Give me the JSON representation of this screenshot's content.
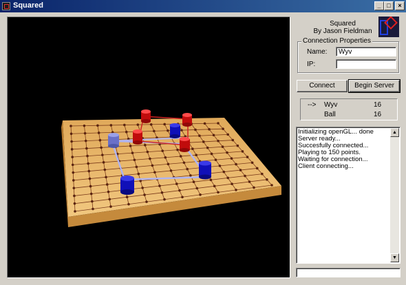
{
  "window": {
    "title": "Squared",
    "minimize_glyph": "_",
    "maximize_glyph": "□",
    "close_glyph": "×"
  },
  "credits": {
    "line1": "Squared",
    "line2": "By Jason Fieldman"
  },
  "connection": {
    "group_title": "Connection Properties",
    "name_label": "Name:",
    "name_value": "Wyv",
    "ip_label": "IP:",
    "ip_value": ""
  },
  "buttons": {
    "connect": "Connect",
    "begin_server": "Begin Server"
  },
  "scores": [
    {
      "marker": "-->",
      "name": "Wyv",
      "score": "16"
    },
    {
      "marker": "",
      "name": "Ball",
      "score": "16"
    }
  ],
  "log": [
    "Initializing openGL... done",
    "Server ready...",
    "Succesfully connected...",
    "Playing to 150 points.",
    "Waiting for connection...",
    "Client connecting..."
  ],
  "chat_input": "",
  "colors": {
    "board": "#e8b765",
    "board_edge": "#c58a3c",
    "red_piece": "#d01010",
    "blue_piece": "#1010c8",
    "light_blue_piece": "#7a80d8",
    "titlebar": "#0a246a"
  },
  "icons": {
    "app": "squared-app-icon",
    "logo": "squared-logo",
    "scroll_up": "up-arrow-icon",
    "scroll_down": "down-arrow-icon"
  }
}
